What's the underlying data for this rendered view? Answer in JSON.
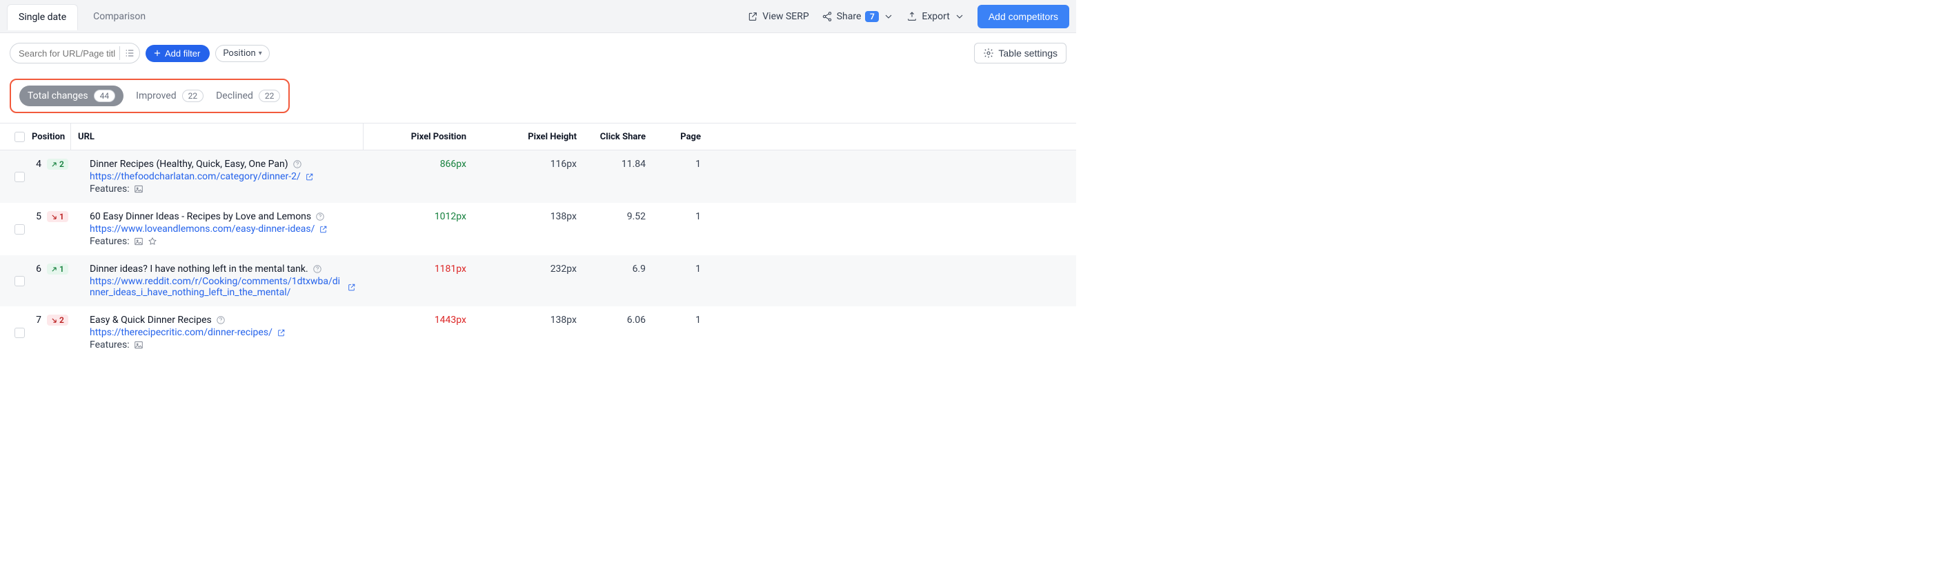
{
  "tabs": {
    "single": "Single date",
    "comparison": "Comparison"
  },
  "topbar": {
    "view_serp": "View SERP",
    "share": "Share",
    "share_count": "7",
    "export": "Export",
    "add_competitors": "Add competitors"
  },
  "filterbar": {
    "search_placeholder": "Search for URL/Page title",
    "add_filter": "Add filter",
    "position": "Position",
    "table_settings": "Table settings"
  },
  "changes": {
    "total_label": "Total changes",
    "total_count": "44",
    "improved_label": "Improved",
    "improved_count": "22",
    "declined_label": "Declined",
    "declined_count": "22"
  },
  "headers": {
    "position": "Position",
    "url": "URL",
    "pixel_position": "Pixel Position",
    "pixel_height": "Pixel Height",
    "click_share": "Click Share",
    "page": "Page"
  },
  "features_label": "Features:",
  "rows": [
    {
      "pos": "4",
      "delta": "2",
      "dir": "up",
      "title": "Dinner Recipes (Healthy, Quick, Easy, One Pan)",
      "url": "https://thefoodcharlatan.com/category/dinner-2/",
      "pp": "866px",
      "pp_state": "good",
      "ph": "116px",
      "cs": "11.84",
      "page": "1",
      "features": [
        "image"
      ]
    },
    {
      "pos": "5",
      "delta": "1",
      "dir": "down",
      "title": "60 Easy Dinner Ideas - Recipes by Love and Lemons",
      "url": "https://www.loveandlemons.com/easy-dinner-ideas/",
      "pp": "1012px",
      "pp_state": "good",
      "ph": "138px",
      "cs": "9.52",
      "page": "1",
      "features": [
        "image",
        "star"
      ]
    },
    {
      "pos": "6",
      "delta": "1",
      "dir": "up",
      "title": "Dinner ideas? I have nothing left in the mental tank.",
      "url": "https://www.reddit.com/r/Cooking/comments/1dtxwba/dinner_ideas_i_have_nothing_left_in_the_mental/",
      "pp": "1181px",
      "pp_state": "bad",
      "ph": "232px",
      "cs": "6.9",
      "page": "1",
      "features": []
    },
    {
      "pos": "7",
      "delta": "2",
      "dir": "down",
      "title": "Easy & Quick Dinner Recipes",
      "url": "https://therecipecritic.com/dinner-recipes/",
      "pp": "1443px",
      "pp_state": "bad",
      "ph": "138px",
      "cs": "6.06",
      "page": "1",
      "features": [
        "image"
      ]
    }
  ]
}
